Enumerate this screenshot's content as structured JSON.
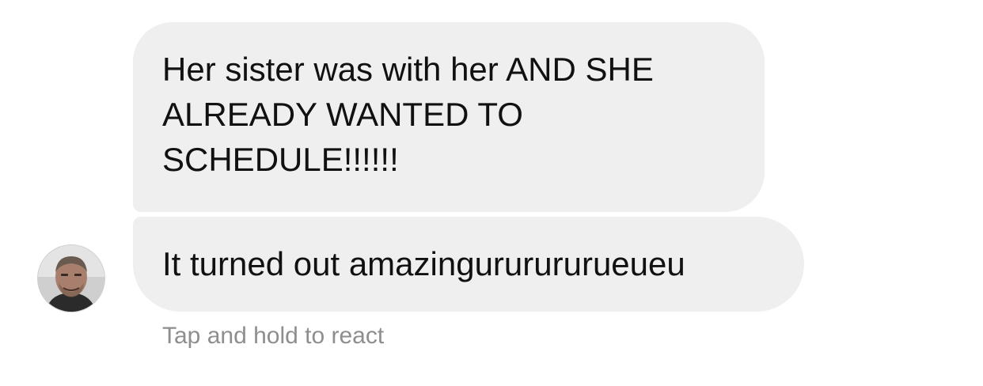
{
  "messages": [
    {
      "text": "Her sister was with her AND SHE ALREADY WANTED TO SCHEDULE!!!!!!"
    },
    {
      "text": "It turned out amazingururururueueu"
    }
  ],
  "hint": "Tap and hold to react",
  "avatar": {
    "icon": "profile-photo"
  },
  "colors": {
    "bubble_bg": "#efefef",
    "text": "#111111",
    "hint": "#8e8e8e"
  }
}
